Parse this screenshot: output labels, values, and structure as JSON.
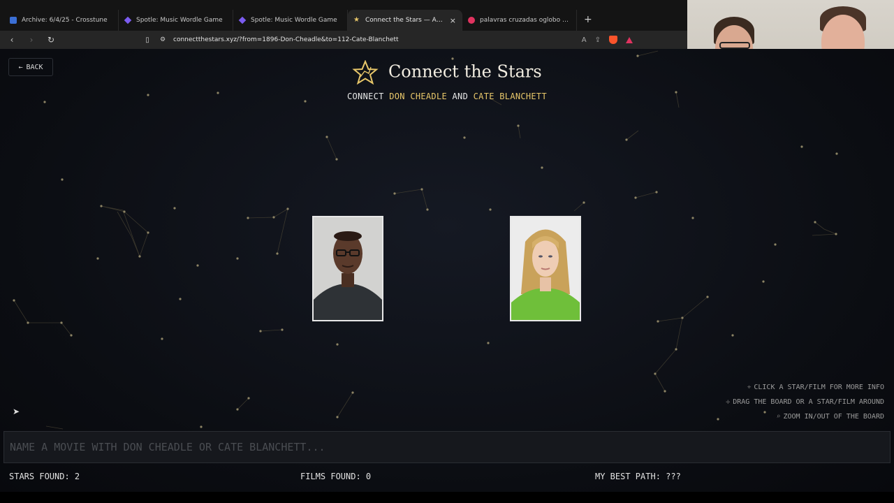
{
  "tabs": [
    {
      "title": "Archive: 6/4/25 - Crosstune",
      "icon": "crosstune-icon",
      "active": false
    },
    {
      "title": "Spotle: Music Wordle Game",
      "icon": "spotle-icon",
      "active": false
    },
    {
      "title": "Spotle: Music Wordle Game",
      "icon": "spotle-icon",
      "active": false
    },
    {
      "title": "Connect the Stars — An endless",
      "icon": "star-icon",
      "active": true
    },
    {
      "title": "palavras cruzadas oglobo - Brave Se",
      "icon": "brave-icon",
      "active": false
    }
  ],
  "new_tab": "+",
  "address": {
    "url": "connectthestars.xyz/?from=1896-Don-Cheadle&to=112-Cate-Blanchett"
  },
  "game": {
    "back_label": "BACK",
    "title": "Connect the Stars",
    "subtitle": {
      "prefix": "CONNECT",
      "star_a": "DON CHEADLE",
      "joiner": "AND",
      "star_b": "CATE BLANCHETT"
    },
    "cards": [
      {
        "name": "Don Cheadle"
      },
      {
        "name": "Cate Blanchett"
      }
    ],
    "hints": [
      "CLICK A STAR/FILM FOR MORE INFO",
      "DRAG THE BOARD OR A STAR/FILM AROUND",
      "ZOOM IN/OUT OF THE BOARD"
    ],
    "input_placeholder": "NAME A MOVIE WITH DON CHEADLE OR CATE BLANCHETT...",
    "stats": {
      "stars_found": "STARS FOUND: 2",
      "films_found": "FILMS FOUND: 0",
      "best_path": "MY BEST PATH: ???"
    }
  },
  "colors": {
    "accent_gold": "#e8c76a",
    "background": "#0b0d12"
  }
}
